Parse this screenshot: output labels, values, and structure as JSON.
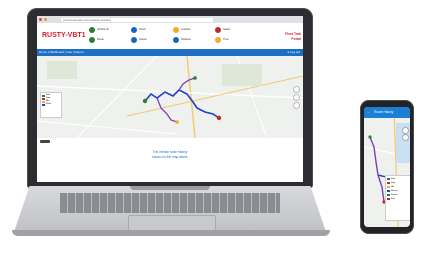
{
  "laptop": {
    "browser": {
      "address": "portal.example.com/vehicle-tracking"
    },
    "header": {
      "logo": "RUSTY-VBT1",
      "brand_line1": "Fleet Trak",
      "brand_line2": "Portal",
      "chips": [
        {
          "label": "Vehicle ID",
          "color": "#2e7d32"
        },
        {
          "label": "Driver",
          "color": "#1565c0"
        },
        {
          "label": "Location",
          "color": "#f9a825"
        },
        {
          "label": "Status",
          "color": "#c62828"
        },
        {
          "label": "Route",
          "color": "#2e7d32"
        },
        {
          "label": "Speed",
          "color": "#1565c0"
        },
        {
          "label": "Distance",
          "color": "#1565c0"
        },
        {
          "label": "Time",
          "color": "#f9a825"
        }
      ]
    },
    "nav": {
      "left": "Home | Dashboard | Live | Report",
      "right": "Log out"
    },
    "legend": [
      {
        "label": "Start",
        "color": "#2e7d32"
      },
      {
        "label": "Stop",
        "color": "#c62828"
      },
      {
        "label": "Idle",
        "color": "#f9a825"
      },
      {
        "label": "Route",
        "color": "#1e40c8"
      }
    ],
    "footer_lines": [
      "The vehicle route history",
      "shown on the map above"
    ]
  },
  "phone": {
    "header_title": "Route History",
    "card_rows": [
      {
        "label": "Start",
        "color": "#2e7d32"
      },
      {
        "label": "Stop",
        "color": "#c62828"
      },
      {
        "label": "Idle",
        "color": "#f9a825"
      },
      {
        "label": "Moving",
        "color": "#1e40c8"
      },
      {
        "label": "Parked",
        "color": "#2e7d32"
      },
      {
        "label": "End",
        "color": "#c62828"
      }
    ]
  },
  "colors": {
    "brand_red": "#d2232a",
    "nav_blue": "#1c6fc5",
    "route_blue": "#1e40c8",
    "route_purple": "#7b3fb5"
  },
  "icons": [
    "map-pin-icon",
    "back-arrow-icon",
    "zoom-control-icon",
    "user-icon"
  ]
}
